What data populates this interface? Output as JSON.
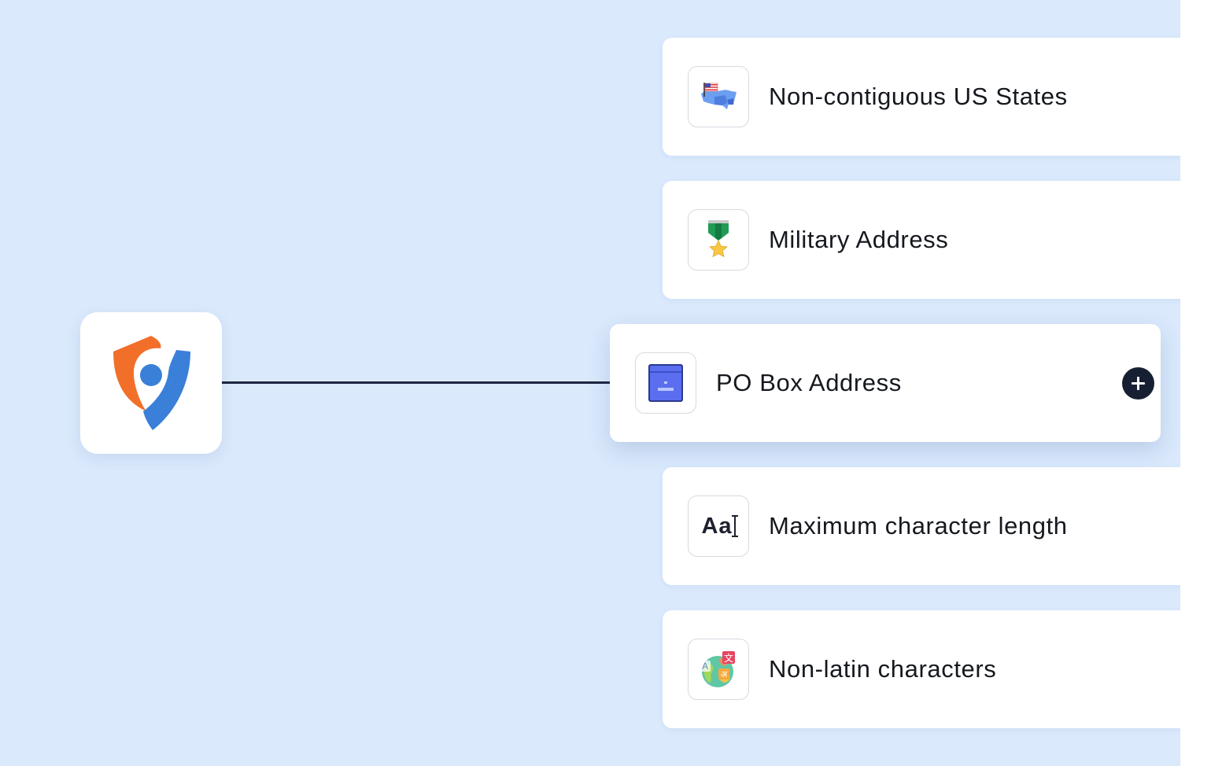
{
  "app": {
    "logo_icon": "shield-location-icon",
    "accent_orange": "#f26f2a",
    "accent_blue": "#3a7fd8",
    "background": "#dae9fc"
  },
  "rules": [
    {
      "label": "Non-contiguous US States",
      "icon": "us-map-flag-icon"
    },
    {
      "label": "Military Address",
      "icon": "military-medal-icon"
    },
    {
      "label": "PO Box Address",
      "icon": "mailbox-icon",
      "active": true,
      "action": "add"
    },
    {
      "label": "Maximum character length",
      "icon": "text-length-icon",
      "icon_text": "Aa"
    },
    {
      "label": "Non-latin characters",
      "icon": "translate-globe-icon",
      "icon_glyphs": [
        "A",
        "文",
        "अ"
      ]
    }
  ]
}
